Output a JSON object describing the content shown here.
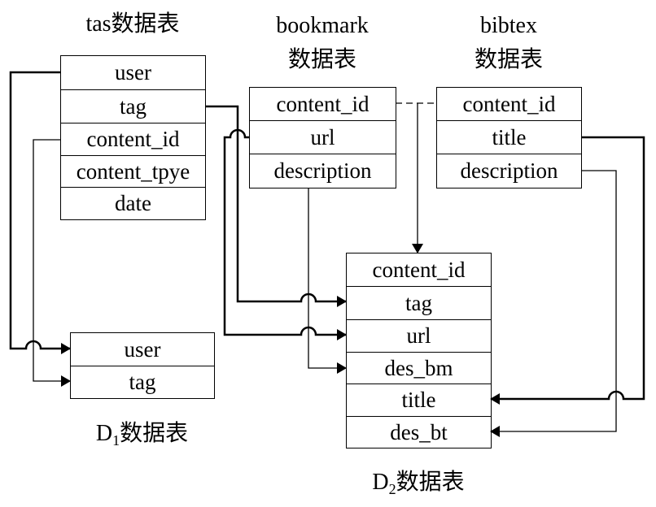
{
  "tables": {
    "tas": {
      "title": "tas数据表",
      "fields": [
        "user",
        "tag",
        "content_id",
        "content_tpye",
        "date"
      ]
    },
    "bookmark": {
      "title_line1": "bookmark",
      "title_line2": "数据表",
      "fields": [
        "content_id",
        "url",
        "description"
      ]
    },
    "bibtex": {
      "title_line1": "bibtex",
      "title_line2": "数据表",
      "fields": [
        "content_id",
        "title",
        "description"
      ]
    },
    "d1": {
      "title_main": "D",
      "title_sub": "1",
      "title_suffix": "数据表",
      "fields": [
        "user",
        "tag"
      ]
    },
    "d2": {
      "title_main": "D",
      "title_sub": "2",
      "title_suffix": "数据表",
      "fields": [
        "content_id",
        "tag",
        "url",
        "des_bm",
        "title",
        "des_bt"
      ]
    }
  },
  "connections": [
    {
      "from": "tas.user",
      "to": "d1.user",
      "style": "bold",
      "arrow": true
    },
    {
      "from": "tas.content_id",
      "to": "d1.tag",
      "style": "thin",
      "arrow": true
    },
    {
      "from": "tas.tag",
      "to": "d2.tag",
      "style": "bold",
      "arrow": true
    },
    {
      "from": "bookmark.url",
      "to": "d2.url",
      "style": "bold",
      "arrow": true
    },
    {
      "from": "bookmark.description",
      "to": "d2.des_bm",
      "style": "thin",
      "arrow": true
    },
    {
      "from": "bookmark.content_id",
      "to": "bibtex.content_id",
      "style": "dashed",
      "arrow": false
    },
    {
      "from": "bookmark.content_id~bibtex.content_id",
      "to": "d2.content_id",
      "style": "thin",
      "arrow": true
    },
    {
      "from": "bibtex.title",
      "to": "d2.title",
      "style": "bold",
      "arrow": true
    },
    {
      "from": "bibtex.description",
      "to": "d2.des_bt",
      "style": "thin",
      "arrow": true
    }
  ]
}
